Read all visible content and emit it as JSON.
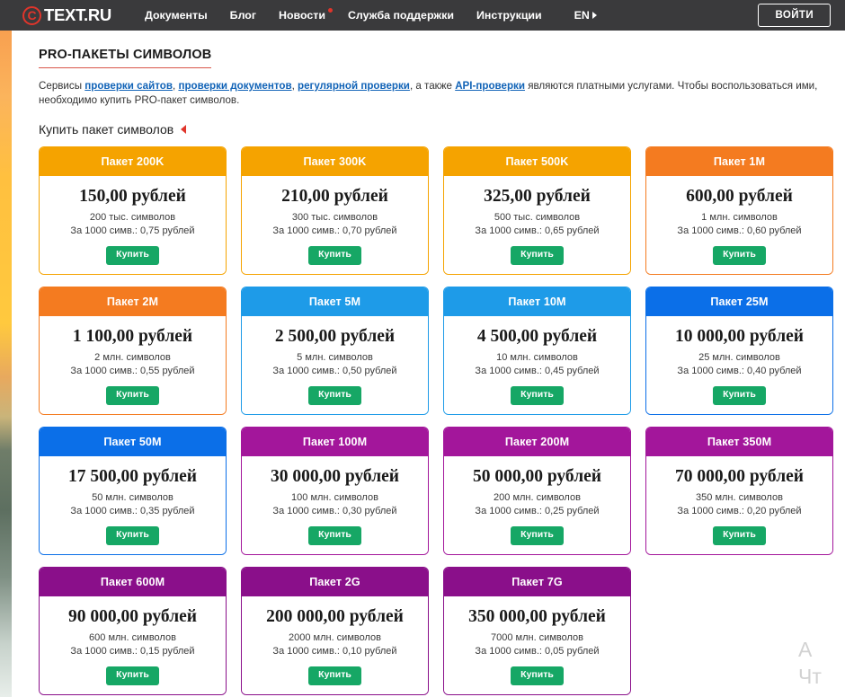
{
  "header": {
    "logo": {
      "mark": "C",
      "text": "TEXT.RU"
    },
    "nav": [
      {
        "label": "Документы",
        "has_dot": false
      },
      {
        "label": "Блог",
        "has_dot": false
      },
      {
        "label": "Новости",
        "has_dot": true
      },
      {
        "label": "Служба поддержки",
        "has_dot": false
      },
      {
        "label": "Инструкции",
        "has_dot": false
      }
    ],
    "lang": "EN",
    "login_label": "ВОЙТИ"
  },
  "main": {
    "title": "PRO-ПАКЕТЫ СИМВОЛОВ",
    "intro": {
      "part1": "Сервисы ",
      "link1": "проверки сайтов",
      "part2": ", ",
      "link2": "проверки документов",
      "part3": ", ",
      "link3": "регулярной проверки",
      "part4": ", а также ",
      "link4": "API-проверки",
      "part5": " являются платными услугами. Чтобы воспользоваться ими, необходимо купить PRO-пакет символов."
    },
    "subhead": "Купить пакет символов"
  },
  "colors": {
    "amber": "#F5A300",
    "orange": "#F47B20",
    "light_blue": "#1E9BE8",
    "blue": "#0B6FE8",
    "magenta": "#A3169B",
    "purple": "#8A0F8A",
    "buy_green": "#16A765",
    "accent_red": "#E0352B",
    "link_blue": "#1163B7"
  },
  "buy_label": "Купить",
  "packages": [
    {
      "name": "Пакет 200K",
      "price": "150,00 рублей",
      "volume": "200 тыс. символов",
      "rate": "За 1000 симв.: 0,75 рублей",
      "color": "#F5A300",
      "border": "#F5A300"
    },
    {
      "name": "Пакет 300K",
      "price": "210,00 рублей",
      "volume": "300 тыс. символов",
      "rate": "За 1000 симв.: 0,70 рублей",
      "color": "#F5A300",
      "border": "#F5A300"
    },
    {
      "name": "Пакет 500K",
      "price": "325,00 рублей",
      "volume": "500 тыс. символов",
      "rate": "За 1000 симв.: 0,65 рублей",
      "color": "#F5A300",
      "border": "#F5A300"
    },
    {
      "name": "Пакет 1M",
      "price": "600,00 рублей",
      "volume": "1 млн. символов",
      "rate": "За 1000 симв.: 0,60 рублей",
      "color": "#F47B20",
      "border": "#F47B20"
    },
    {
      "name": "Пакет 2M",
      "price": "1 100,00 рублей",
      "volume": "2 млн. символов",
      "rate": "За 1000 симв.: 0,55 рублей",
      "color": "#F47B20",
      "border": "#F47B20"
    },
    {
      "name": "Пакет 5M",
      "price": "2 500,00 рублей",
      "volume": "5 млн. символов",
      "rate": "За 1000 симв.: 0,50 рублей",
      "color": "#1E9BE8",
      "border": "#1E9BE8"
    },
    {
      "name": "Пакет 10M",
      "price": "4 500,00 рублей",
      "volume": "10 млн. символов",
      "rate": "За 1000 симв.: 0,45 рублей",
      "color": "#1E9BE8",
      "border": "#1E9BE8"
    },
    {
      "name": "Пакет 25M",
      "price": "10 000,00 рублей",
      "volume": "25 млн. символов",
      "rate": "За 1000 симв.: 0,40 рублей",
      "color": "#0B6FE8",
      "border": "#0B6FE8"
    },
    {
      "name": "Пакет 50M",
      "price": "17 500,00 рублей",
      "volume": "50 млн. символов",
      "rate": "За 1000 симв.: 0,35 рублей",
      "color": "#0B6FE8",
      "border": "#0B6FE8"
    },
    {
      "name": "Пакет 100M",
      "price": "30 000,00 рублей",
      "volume": "100 млн. символов",
      "rate": "За 1000 симв.: 0,30 рублей",
      "color": "#A3169B",
      "border": "#A3169B"
    },
    {
      "name": "Пакет 200M",
      "price": "50 000,00 рублей",
      "volume": "200 млн. символов",
      "rate": "За 1000 симв.: 0,25 рублей",
      "color": "#A3169B",
      "border": "#A3169B"
    },
    {
      "name": "Пакет 350M",
      "price": "70 000,00 рублей",
      "volume": "350 млн. символов",
      "rate": "За 1000 симв.: 0,20 рублей",
      "color": "#A3169B",
      "border": "#A3169B"
    },
    {
      "name": "Пакет 600M",
      "price": "90 000,00 рублей",
      "volume": "600 млн. символов",
      "rate": "За 1000 симв.: 0,15 рублей",
      "color": "#8A0F8A",
      "border": "#8A0F8A"
    },
    {
      "name": "Пакет 2G",
      "price": "200 000,00 рублей",
      "volume": "2000 млн. символов",
      "rate": "За 1000 симв.: 0,10 рублей",
      "color": "#8A0F8A",
      "border": "#8A0F8A"
    },
    {
      "name": "Пакет 7G",
      "price": "350 000,00 рублей",
      "volume": "7000 млн. символов",
      "rate": "За 1000 симв.: 0,05 рублей",
      "color": "#8A0F8A",
      "border": "#8A0F8A"
    }
  ],
  "corner_widget": {
    "line1": "A",
    "line2": "Чт"
  }
}
